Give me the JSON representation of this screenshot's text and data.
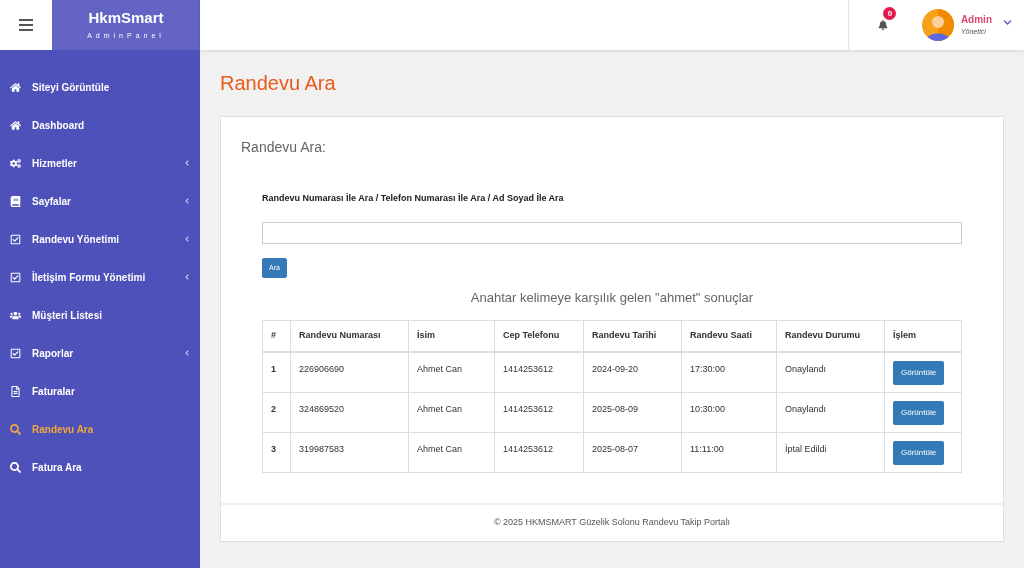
{
  "brand": {
    "title": "HkmSmart",
    "subtitle": "AdminPanel"
  },
  "header": {
    "notification_count": "0",
    "user_name": "Admin",
    "user_role": "Yönetici"
  },
  "sidebar": {
    "items": [
      {
        "label": "Siteyi Görüntüle",
        "has_submenu": false,
        "selected": false
      },
      {
        "label": "Dashboard",
        "has_submenu": false,
        "selected": false
      },
      {
        "label": "Hizmetler",
        "has_submenu": true,
        "selected": false
      },
      {
        "label": "Sayfalar",
        "has_submenu": true,
        "selected": false
      },
      {
        "label": "Randevu Yönetimi",
        "has_submenu": true,
        "selected": false
      },
      {
        "label": "İletişim Formu Yönetimi",
        "has_submenu": true,
        "selected": false
      },
      {
        "label": "Müşteri Listesi",
        "has_submenu": false,
        "selected": false
      },
      {
        "label": "Raporlar",
        "has_submenu": true,
        "selected": false
      },
      {
        "label": "Faturalar",
        "has_submenu": false,
        "selected": false
      },
      {
        "label": "Randevu Ara",
        "has_submenu": false,
        "selected": true
      },
      {
        "label": "Fatura Ara",
        "has_submenu": false,
        "selected": false
      }
    ]
  },
  "page_title": "Randevu Ara",
  "card": {
    "heading": "Randevu Ara:",
    "search_label": "Randevu Numarası İle Ara / Telefon Numarası İle Ara / Ad Soyad İle Ara",
    "search_button": "Ara",
    "results_caption": "Anahtar kelimeye karşılık gelen \"ahmet\" sonuçlar"
  },
  "table": {
    "columns": [
      "#",
      "Randevu Numarası",
      "İsim",
      "Cep Telefonu",
      "Randevu Tarihi",
      "Randevu Saati",
      "Randevu Durumu",
      "İşlem"
    ],
    "rows": [
      {
        "index": "1",
        "number": "226906690",
        "name": "Ahmet Can",
        "phone": "1414253612",
        "date": "2024-09-20",
        "time": "17:30:00",
        "status": "Onaylandı",
        "action": "Görüntüle"
      },
      {
        "index": "2",
        "number": "324869520",
        "name": "Ahmet Can",
        "phone": "1414253612",
        "date": "2025-08-09",
        "time": "10:30:00",
        "status": "Onaylandı",
        "action": "Görüntüle"
      },
      {
        "index": "3",
        "number": "319987583",
        "name": "Ahmet Can",
        "phone": "1414253612",
        "date": "2025-08-07",
        "time": "11:11:00",
        "status": "İptal Edildi",
        "action": "Görüntüle"
      }
    ]
  },
  "footer": "© 2025 HKMSMART Güzelik Solonu Randevu Takip Portalı"
}
